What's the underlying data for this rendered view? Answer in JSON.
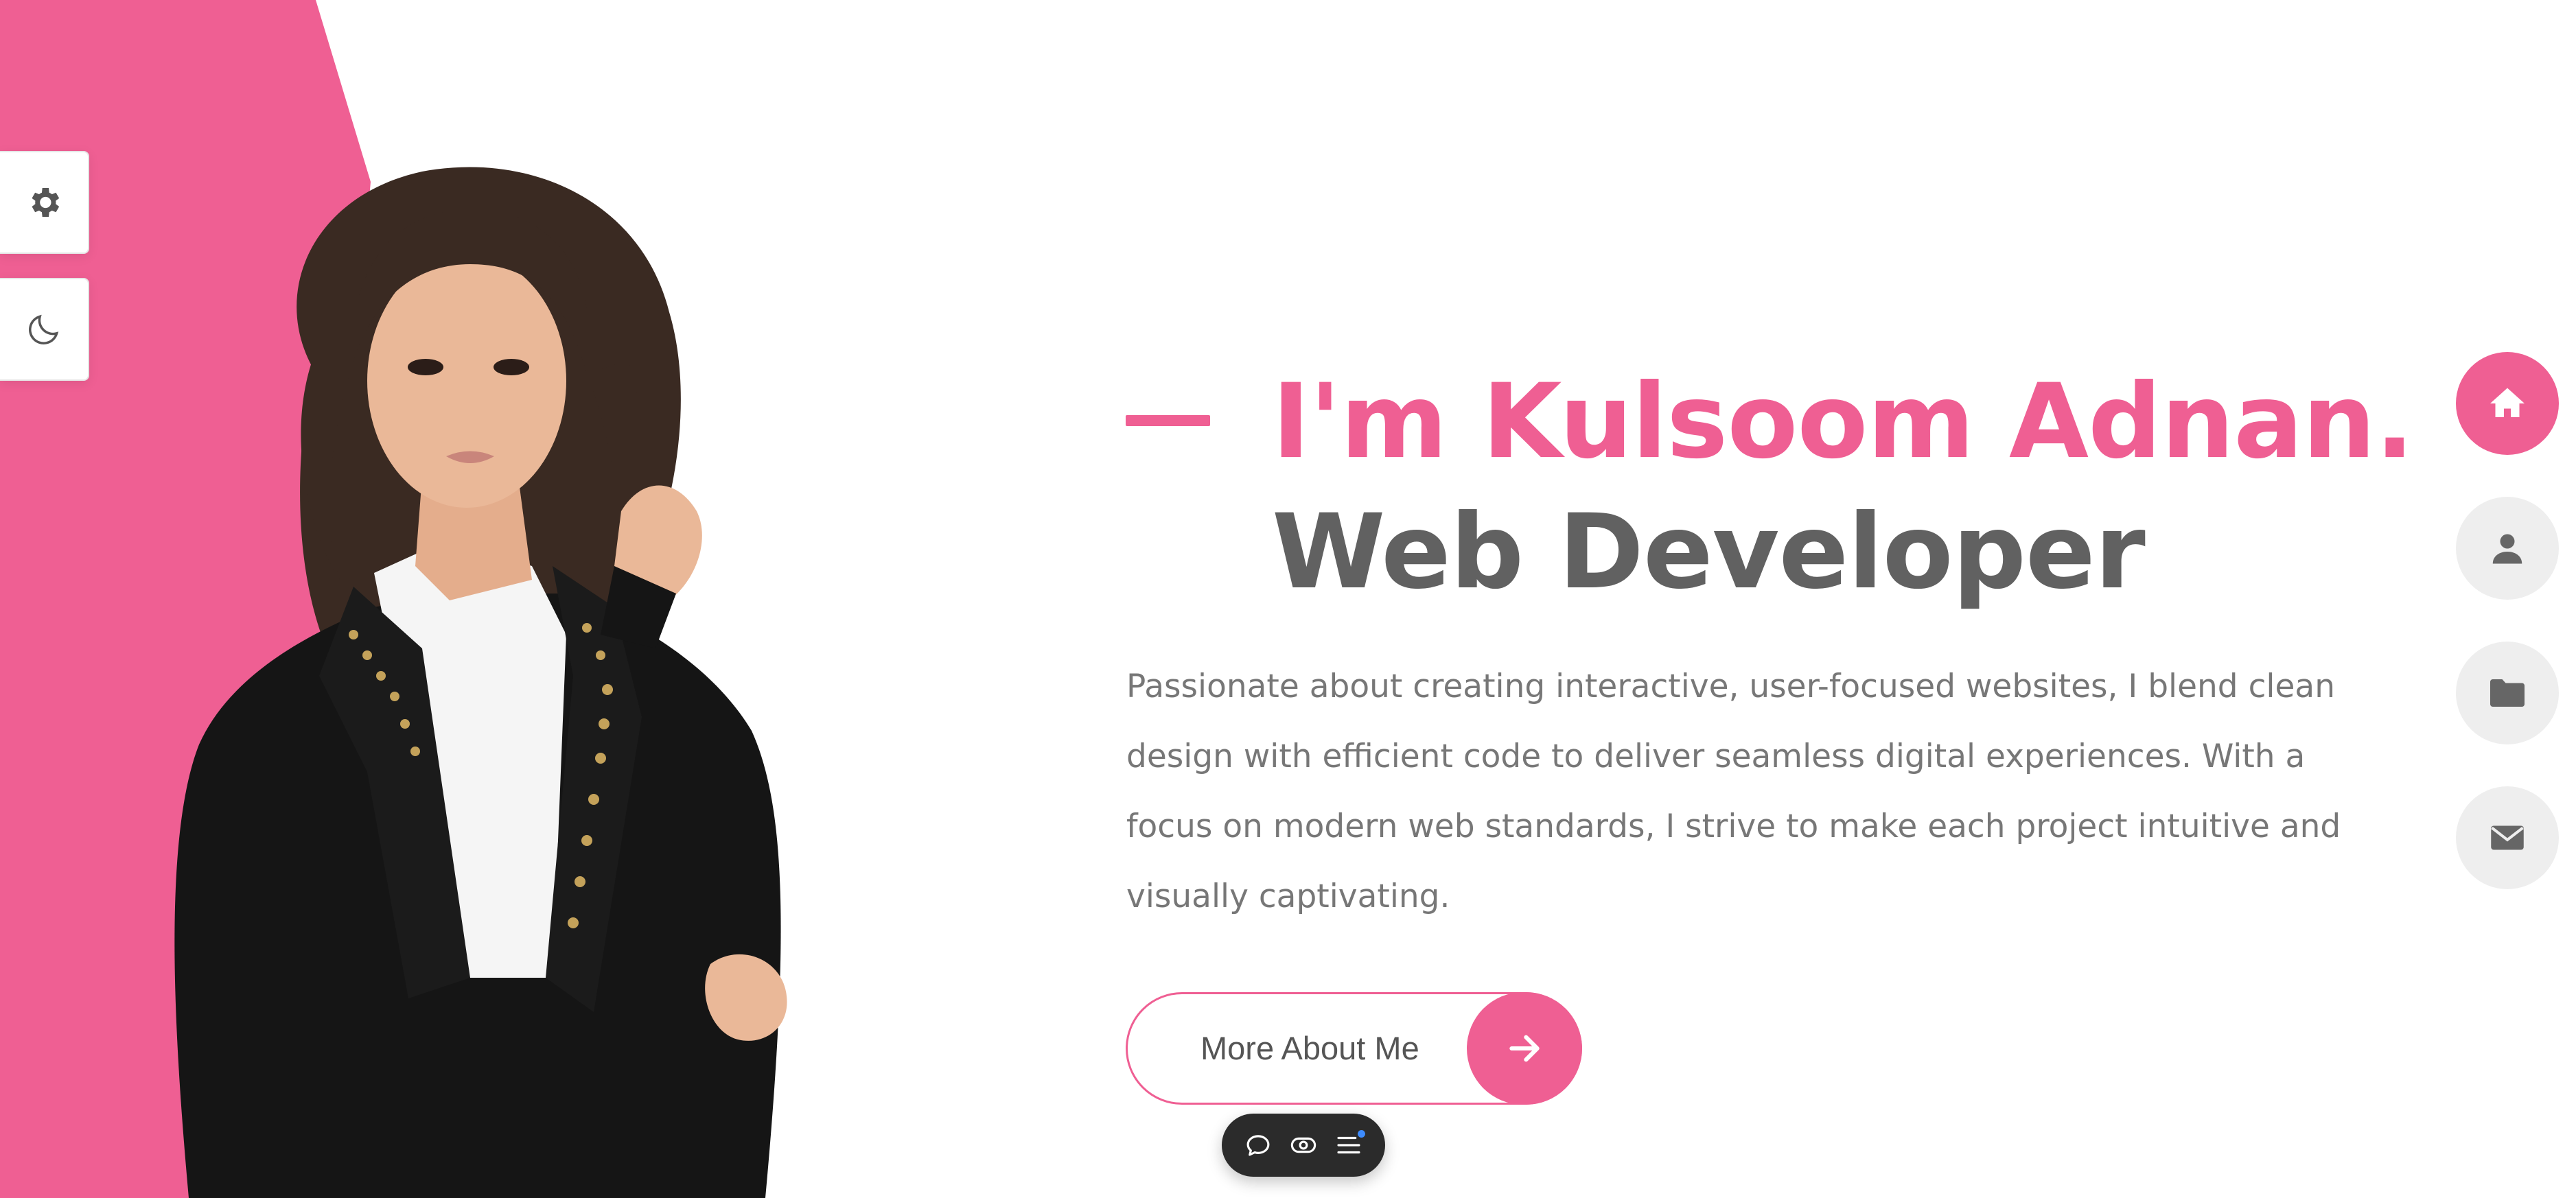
{
  "theme": {
    "accent": "#ef5f93",
    "heading_secondary": "#616161",
    "body_text": "#777777",
    "nav_inactive_bg": "#eeeeee",
    "nav_icon": "#666666",
    "widget_bg": "#2b2b2b"
  },
  "side_tools": [
    {
      "name": "settings",
      "icon": "gear-icon"
    },
    {
      "name": "dark-mode-toggle",
      "icon": "moon-icon"
    }
  ],
  "portrait": {
    "alt": "portrait-photo"
  },
  "hero": {
    "name": "I'm Kulsoom Adnan.",
    "role": "Web Developer",
    "description": "Passionate about creating interactive, user-focused websites, I blend clean design with efficient code to deliver seamless digital experiences. With a focus on modern web standards, I strive to make each project intuitive and visually captivating."
  },
  "cta": {
    "label": "More About Me",
    "icon": "arrow-right-icon"
  },
  "right_nav": [
    {
      "name": "home",
      "icon": "home-icon",
      "active": true
    },
    {
      "name": "about",
      "icon": "user-icon",
      "active": false
    },
    {
      "name": "portfolio",
      "icon": "folder-icon",
      "active": false
    },
    {
      "name": "contact",
      "icon": "envelope-icon",
      "active": false
    }
  ],
  "widget": {
    "items": [
      {
        "name": "chat",
        "icon": "chat-bubble-icon"
      },
      {
        "name": "visibility",
        "icon": "eye-toggle-icon"
      },
      {
        "name": "menu",
        "icon": "menu-icon",
        "has_notification": true
      }
    ]
  }
}
